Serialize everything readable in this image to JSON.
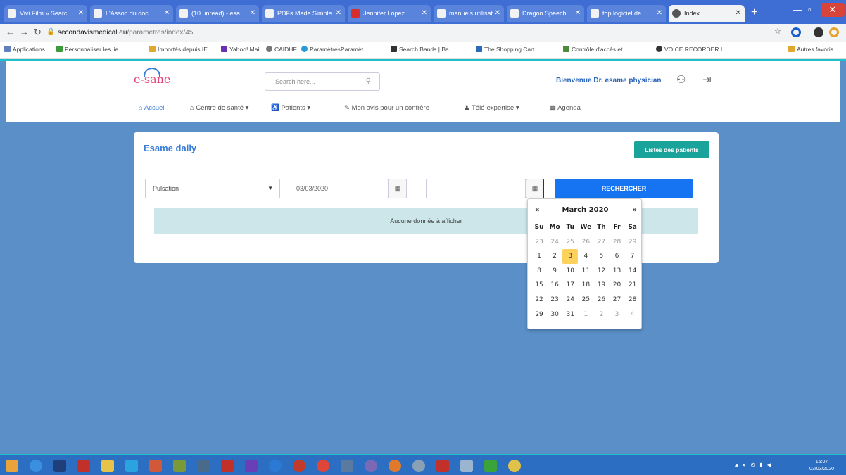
{
  "browser": {
    "tabs": [
      {
        "label": "Vivi Film » Searc"
      },
      {
        "label": "L'Assoc du doc"
      },
      {
        "label": "(10 unread) - esa"
      },
      {
        "label": "PDFs Made Simple"
      },
      {
        "label": "Jennifer Lopez"
      },
      {
        "label": "manuels utilisat"
      },
      {
        "label": "Dragon Speech"
      },
      {
        "label": "top logiciel de"
      },
      {
        "label": "Index"
      }
    ],
    "url_host": "secondavismedical.eu",
    "url_path": "/parametres/index/45",
    "bookmarks": [
      "Applications",
      "Personnaliser les lie...",
      "Importés depuis IE",
      "Yahoo! Mail",
      "CAIDHF",
      "ParamètresParamèt...",
      "Search Bands | Ba...",
      "The Shopping Cart ...",
      "Contrôle d'accès et...",
      "VOICE RECORDER I...",
      "Autres favoris"
    ]
  },
  "site": {
    "logo": "e-sane",
    "search_placeholder": "Search here...",
    "welcome": "Bienvenue Dr. esame physician",
    "menu": [
      {
        "label": "Accueil"
      },
      {
        "label": "Centre de santé ▾"
      },
      {
        "label": "Patients ▾"
      },
      {
        "label": "Mon avis pour un confrère"
      },
      {
        "label": "Télé-expertise ▾"
      },
      {
        "label": "Agenda"
      }
    ]
  },
  "card": {
    "title": "Esame daily",
    "patients_button": "Listes des patients",
    "select_value": "Pulsation",
    "date_from": "03/03/2020",
    "date_to": "",
    "search_button": "RECHERCHER",
    "no_data": "Aucune donnée à afficher"
  },
  "datepicker": {
    "prev": "«",
    "next": "»",
    "title": "March 2020",
    "days_of_week": [
      "Su",
      "Mo",
      "Tu",
      "We",
      "Th",
      "Fr",
      "Sa"
    ],
    "weeks": [
      [
        "23",
        "24",
        "25",
        "26",
        "27",
        "28",
        "29"
      ],
      [
        "1",
        "2",
        "3",
        "4",
        "5",
        "6",
        "7"
      ],
      [
        "8",
        "9",
        "10",
        "11",
        "12",
        "13",
        "14"
      ],
      [
        "15",
        "16",
        "17",
        "18",
        "19",
        "20",
        "21"
      ],
      [
        "22",
        "23",
        "24",
        "25",
        "26",
        "27",
        "28"
      ],
      [
        "29",
        "30",
        "31",
        "1",
        "2",
        "3",
        "4"
      ]
    ],
    "selected_day": "3"
  },
  "taskbar": {
    "clock_time": "16:07",
    "clock_date": "03/03/2020"
  }
}
